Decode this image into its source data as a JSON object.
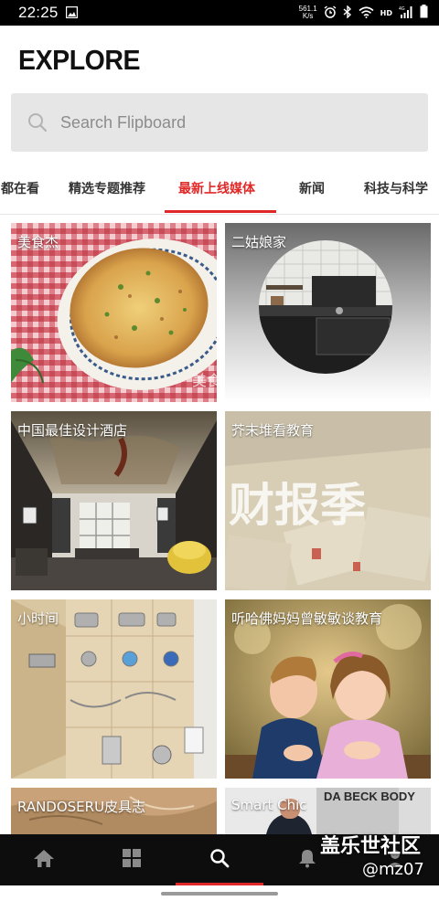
{
  "status_bar": {
    "time": "22:25",
    "net_speed_value": "561.1",
    "net_speed_unit": "K/s",
    "hd_label": "HD",
    "signal_label": "4G"
  },
  "header": {
    "title": "EXPLORE"
  },
  "search": {
    "placeholder": "Search Flipboard"
  },
  "tabs": [
    {
      "label": "都在看"
    },
    {
      "label": "精选专题推荐"
    },
    {
      "label": "最新上线媒体",
      "active": true
    },
    {
      "label": "新闻"
    },
    {
      "label": "科技与科学"
    }
  ],
  "tiles": [
    {
      "label": "美食杰",
      "image": "potato-pancake-photo"
    },
    {
      "label": "二姑娘家",
      "image": "dark-kitchen-circle-photo"
    },
    {
      "label": "中国最佳设计酒店",
      "image": "hotel-lounge-photo"
    },
    {
      "label": "芥末堆看教育",
      "image": "report-season-photo",
      "overlay_text": "财报季"
    },
    {
      "label": "小时间",
      "image": "busy-board-photo"
    },
    {
      "label": "听哈佛妈妈曾敏敏谈教育",
      "image": "children-kiss-photo"
    },
    {
      "label": "RANDOSERU皮具志",
      "image": "leather-photo"
    },
    {
      "label": "Smart Chic",
      "image": "fashion-photo",
      "photo_text": "DA BECK BODY"
    }
  ],
  "tile_text": {
    "meishi_watermark": "美食"
  },
  "bottom_nav": [
    {
      "name": "home",
      "icon": "home-icon"
    },
    {
      "name": "grid",
      "icon": "grid-icon"
    },
    {
      "name": "search",
      "icon": "search-icon",
      "active": true
    },
    {
      "name": "notifications",
      "icon": "bell-icon"
    },
    {
      "name": "profile",
      "icon": "profile-icon"
    }
  ],
  "watermark": {
    "line1": "盖乐世社区",
    "line2": "@mz07"
  },
  "colors": {
    "accent": "#e12828",
    "search_bg": "#e6e6e6",
    "nav_bg": "#0d0d0d"
  }
}
